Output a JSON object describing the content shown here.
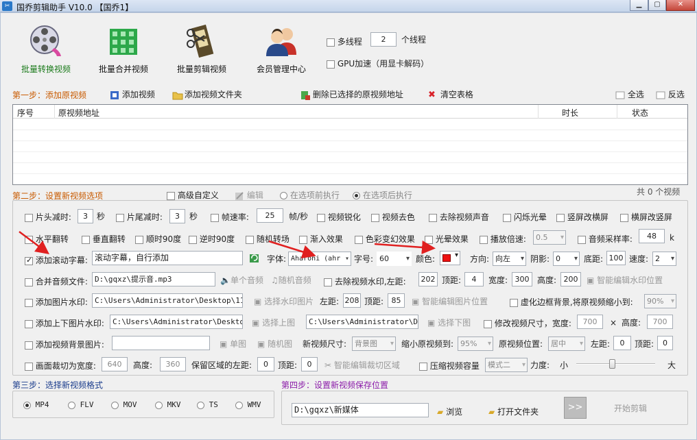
{
  "window": {
    "title": "国乔剪辑助手 V10.0 【国乔1】",
    "icon": "scissors-app-icon",
    "controls": [
      "minimize",
      "maximize",
      "close"
    ]
  },
  "toolbar": {
    "items": [
      {
        "label": "批量转换视频",
        "icon": "film-reel-icon",
        "active": true
      },
      {
        "label": "批量合并视频",
        "icon": "merge-blocks-icon",
        "active": false
      },
      {
        "label": "批量剪辑视频",
        "icon": "film-strip-scissors-icon",
        "active": false
      },
      {
        "label": "会员管理中心",
        "icon": "users-icon",
        "active": false
      }
    ],
    "multithread_label": "多线程",
    "thread_count": "2",
    "thread_unit": "个线程",
    "gpu_label": "GPU加速（用显卡解码）"
  },
  "step1": {
    "title": "第一步：添加原视频",
    "add_video": "添加视频",
    "add_folder": "添加视频文件夹",
    "delete_selected": "删除已选择的原视频地址",
    "clear_table": "清空表格",
    "select_all": "全选",
    "invert_select": "反选",
    "table_headers": [
      "序号",
      "原视频地址",
      "时长",
      "状态"
    ]
  },
  "step2": {
    "title": "第二步：设置新视频选项",
    "advanced_custom": "高级自定义",
    "edit": "编辑",
    "exec_before": "在选项前执行",
    "exec_after": "在选项后执行",
    "video_count": "共 0 个视频",
    "row1": {
      "head_cut": "片头减时:",
      "head_val": "3",
      "sec1": "秒",
      "tail_cut": "片尾减时:",
      "tail_val": "3",
      "sec2": "秒",
      "fps": "帧速率:",
      "fps_val": "25",
      "fps_unit": "帧/秒",
      "sharpen": "视频锐化",
      "decolor": "视频去色",
      "remove_audio": "去除视频声音",
      "flash": "闪烁光晕",
      "v2h": "竖屏改横屏",
      "h2v": "横屏改竖屏"
    },
    "row2": {
      "hflip": "水平翻转",
      "vflip": "垂直翻转",
      "cw90": "顺时90度",
      "ccw90": "逆时90度",
      "random_transition": "随机转场",
      "fade_in": "渐入效果",
      "color_change": "色彩变幻效果",
      "halo": "光晕效果",
      "speed": "播放倍速:",
      "speed_val": "0.5",
      "sample_rate": "音频采样率:",
      "sample_val": "48",
      "sample_unit": "k"
    },
    "row3": {
      "scroll_sub": "添加滚动字幕:",
      "scroll_text": "滚动字幕，自行添加",
      "font": "字体:",
      "font_val": "Aharoni (ahr",
      "size": "字号:",
      "size_val": "60",
      "color": "颜色:",
      "color_hex": "#e11111",
      "direction": "方向:",
      "direction_val": "向左",
      "shadow": "阴影:",
      "shadow_val": "0",
      "bottom": "底距:",
      "bottom_val": "100",
      "speed": "速度:",
      "speed_val": "2"
    },
    "row4": {
      "merge_audio": "合并音频文件:",
      "audio_path": "D:\\gqxz\\提示音.mp3",
      "single_audio": "单个音频",
      "random_audio": "随机音频",
      "remove_watermark": "去除视频水印,左距:",
      "wm_left": "202",
      "top": "顶距:",
      "wm_top": "4",
      "width": "宽度:",
      "wm_width": "300",
      "height": "高度:",
      "wm_height": "200",
      "smart_wm": "智能编辑水印位置"
    },
    "row5": {
      "img_watermark": "添加图片水印:",
      "img_path": "C:\\Users\\Administrator\\Desktop\\111.j",
      "choose_wm_img": "选择水印图片",
      "left": "左距:",
      "img_left": "208",
      "top": "顶距:",
      "img_top": "85",
      "smart_img": "智能编辑图片位置",
      "blur_bg": "虚化边框背景,将原视频缩小到:",
      "blur_val": "90%"
    },
    "row6": {
      "tb_watermark": "添加上下图片水印:",
      "top_path": "C:\\Users\\Administrator\\Desktop\\i",
      "choose_top": "选择上图",
      "bottom_path": "C:\\Users\\Administrator\\Desk",
      "choose_bottom": "选择下图",
      "resize": "修改视频尺寸，宽度:",
      "resize_w": "700",
      "times": "×",
      "height": "高度:",
      "resize_h": "700"
    },
    "row7": {
      "bg_image": "添加视频背景图片:",
      "single_img": "单图",
      "random_img": "随机图",
      "new_size": "新视频尺寸:",
      "new_size_val": "背景图",
      "shrink": "缩小原视频到:",
      "shrink_val": "95%",
      "pos": "原视频位置:",
      "pos_val": "居中",
      "left": "左距:",
      "left_val": "0",
      "top": "顶距:",
      "top_val": "0"
    },
    "row8": {
      "crop": "画面裁切为宽度:",
      "crop_w": "640",
      "height": "高度:",
      "crop_h": "360",
      "keep_left": "保留区域的左距:",
      "keep_left_val": "0",
      "top": "顶距:",
      "keep_top_val": "0",
      "smart_crop": "智能编辑裁切区域",
      "compress": "压缩视频容量",
      "mode_val": "模式二",
      "strength": "力度:",
      "small": "小",
      "large": "大",
      "strength_level": 0.45
    }
  },
  "step3": {
    "title": "第三步：选择新视频格式",
    "formats": [
      "MP4",
      "FLV",
      "MOV",
      "MKV",
      "TS",
      "WMV"
    ],
    "selected": "MP4"
  },
  "step4": {
    "title": "第四步：设置新视频保存位置",
    "path": "D:\\gqxz\\新媒体",
    "browse": "浏览",
    "open_folder": "打开文件夹",
    "run_icon": ">>",
    "start": "开始剪辑"
  },
  "colors": {
    "step_orange": "#c85a00",
    "step_blue": "#1a3c8c",
    "step_purple": "#8a1aa8",
    "active_green": "#1a7a1a",
    "arrow_red": "#e02020"
  }
}
